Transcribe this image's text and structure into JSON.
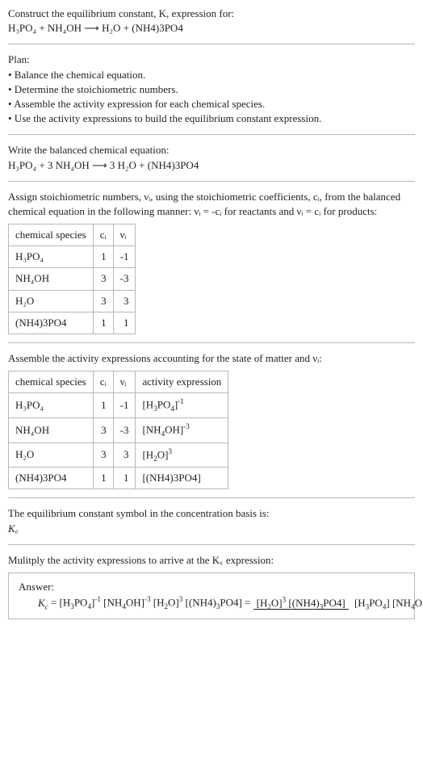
{
  "intro": {
    "line1": "Construct the equilibrium constant, K, expression for:",
    "eq": "H₃PO₄ + NH₄OH ⟶ H₂O + (NH4)3PO4"
  },
  "plan": {
    "title": "Plan:",
    "b1": "• Balance the chemical equation.",
    "b2": "• Determine the stoichiometric numbers.",
    "b3": "• Assemble the activity expression for each chemical species.",
    "b4": "• Use the activity expressions to build the equilibrium constant expression."
  },
  "balanced": {
    "line1": "Write the balanced chemical equation:",
    "eq": "H₃PO₄ + 3 NH₄OH ⟶ 3 H₂O + (NH4)3PO4"
  },
  "stoich": {
    "text": "Assign stoichiometric numbers, νᵢ, using the stoichiometric coefficients, cᵢ, from the balanced chemical equation in the following manner: νᵢ = -cᵢ for reactants and νᵢ = cᵢ for products:",
    "h1": "chemical species",
    "h2": "cᵢ",
    "h3": "νᵢ",
    "r1c1": "H₃PO₄",
    "r1c2": "1",
    "r1c3": "-1",
    "r2c1": "NH₄OH",
    "r2c2": "3",
    "r2c3": "-3",
    "r3c1": "H₂O",
    "r3c2": "3",
    "r3c3": "3",
    "r4c1": "(NH4)3PO4",
    "r4c2": "1",
    "r4c3": "1"
  },
  "activity": {
    "text": "Assemble the activity expressions accounting for the state of matter and νᵢ:",
    "h1": "chemical species",
    "h2": "cᵢ",
    "h3": "νᵢ",
    "h4": "activity expression",
    "r1c1": "H₃PO₄",
    "r1c2": "1",
    "r1c3": "-1",
    "r2c1": "NH₄OH",
    "r2c2": "3",
    "r2c3": "-3",
    "r3c1": "H₂O",
    "r3c2": "3",
    "r3c3": "3",
    "r4c1": "(NH4)3PO4",
    "r4c2": "1",
    "r4c3": "1",
    "r4c4": "[(NH4)3PO4]"
  },
  "symbol": {
    "line1": "The equilibrium constant symbol in the concentration basis is:",
    "line2": "K꜀"
  },
  "multiply": {
    "text": "Mulitply the activity expressions to arrive at the K꜀ expression:"
  },
  "answer": {
    "label": "Answer:"
  }
}
